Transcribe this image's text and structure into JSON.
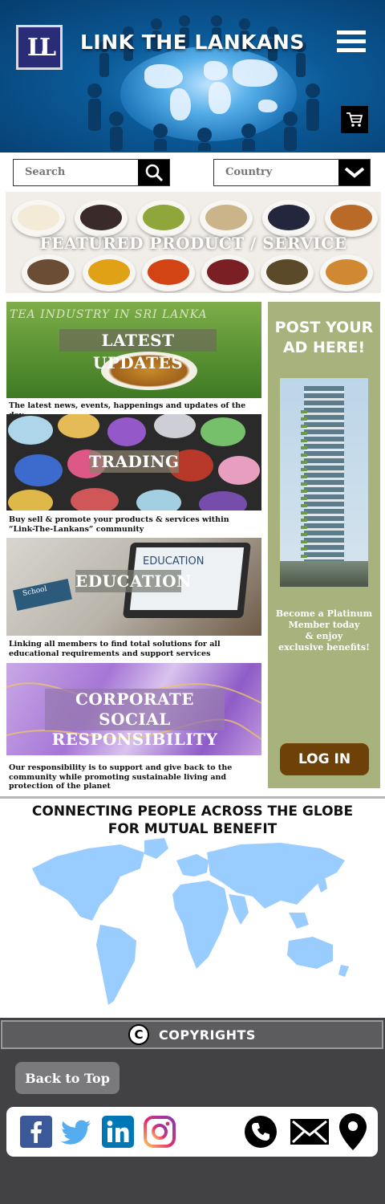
{
  "header": {
    "logo_text": "LL",
    "title": "LINK THE LANKANS"
  },
  "search": {
    "placeholder": "Search"
  },
  "country": {
    "placeholder": "Country"
  },
  "featured": {
    "title": "FEATURED PRODUCT / SERVICE"
  },
  "sections": [
    {
      "title": "LATEST UPDATES",
      "image_text": "TEA INDUSTRY IN SRI LANKA",
      "description": "The latest news, events, happenings and updates of the day"
    },
    {
      "title": "TRADING",
      "description": "Buy sell & promote your products & services within “Link-The-Lankans” community"
    },
    {
      "title": "EDUCATION",
      "image_text": "EDUCATION",
      "book_text": "School",
      "description": "Linking all members to find total solutions for all educational requirements and support services"
    },
    {
      "title_line1": "CORPORATE SOCIAL",
      "title_line2": "RESPONSIBILITY",
      "description": "Our responsibility is to support and give back to the community while promoting sustainable living and protection of the planet"
    }
  ],
  "ad": {
    "title_line1": "POST YOUR",
    "title_line2": "AD HERE!",
    "text_line1": "Become a Platinum",
    "text_line2": "Member today",
    "text_line3": "& enjoy",
    "text_line4": "exclusive benefits!",
    "login_label": "LOG IN"
  },
  "connect": {
    "line1": "CONNECTING PEOPLE ACROSS THE GLOBE",
    "line2": "FOR MUTUAL BENEFIT"
  },
  "footer": {
    "copyright_label": "COPYRIGHTS",
    "copyright_symbol": "C",
    "back_to_top": "Back to Top",
    "social_icons": [
      "facebook-icon",
      "twitter-icon",
      "linkedin-icon",
      "instagram-icon"
    ],
    "contact_icons": [
      "phone-icon",
      "mail-icon",
      "location-icon"
    ]
  },
  "colors": {
    "header_blue": "#0b5a98",
    "ad_green": "#a7b27c",
    "login_brown": "#6e4108",
    "footer_gray": "#424244",
    "map_blue": "#99ccff"
  }
}
